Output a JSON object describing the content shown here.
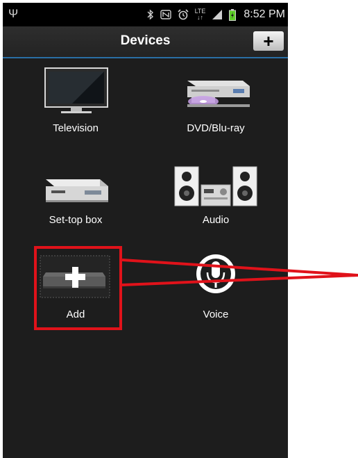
{
  "status_bar": {
    "time": "8:52 PM",
    "network": "LTE",
    "icons": [
      "usb-icon",
      "bluetooth-icon",
      "nfc-icon",
      "alarm-icon",
      "lte-icon",
      "signal-icon",
      "battery-icon"
    ]
  },
  "header": {
    "title": "Devices",
    "add_button_icon": "plus-icon"
  },
  "devices": [
    {
      "label": "Television",
      "icon": "television-icon"
    },
    {
      "label": "DVD/Blu-ray",
      "icon": "dvd-player-icon"
    },
    {
      "label": "Set-top box",
      "icon": "set-top-box-icon"
    },
    {
      "label": "Audio",
      "icon": "audio-system-icon"
    },
    {
      "label": "Add",
      "icon": "add-device-icon"
    },
    {
      "label": "Voice",
      "icon": "microphone-icon"
    }
  ],
  "annotation": {
    "color": "#e0121a"
  },
  "colors": {
    "background": "#1d1d1d",
    "accent": "#2a6fa5",
    "text": "#ffffff"
  }
}
